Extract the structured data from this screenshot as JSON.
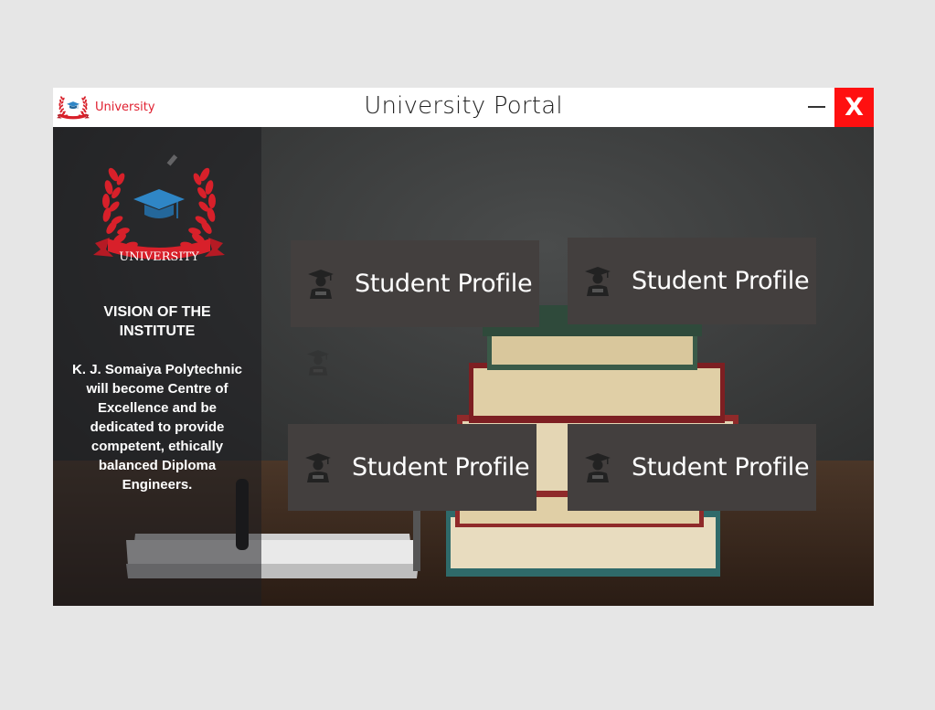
{
  "window": {
    "title": "University Portal",
    "brand_name": "University",
    "close_label": "X"
  },
  "sidebar": {
    "logo_text": "UNIVERSITY",
    "vision_title": "VISION OF THE INSTITUTE",
    "vision_text": "K. J. Somaiya Polytechnic will become Centre of Excellence and be dedicated to provide competent, ethically balanced Diploma Engineers."
  },
  "tiles": [
    {
      "label": "Student Profile",
      "icon": "student-graduate-icon"
    },
    {
      "label": "Student Profile",
      "icon": "student-graduate-icon"
    },
    {
      "label": "Student Profile",
      "icon": "student-graduate-icon"
    },
    {
      "label": "Student Profile",
      "icon": "student-graduate-icon"
    }
  ],
  "colors": {
    "close": "#ff1010",
    "brand": "#e02030",
    "tile": "#433f3e",
    "cap": "#2f86c6"
  }
}
